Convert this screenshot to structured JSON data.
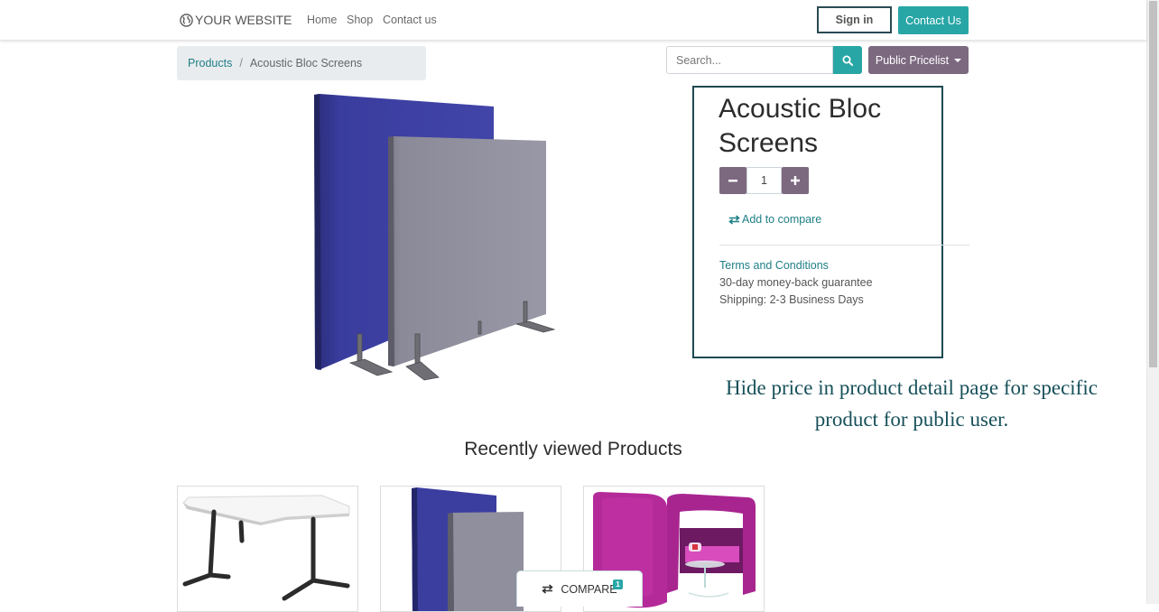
{
  "header": {
    "brand": "YOUR WEBSITE",
    "nav": [
      "Home",
      "Shop",
      "Contact us"
    ],
    "sign_in": "Sign in",
    "contact_us": "Contact Us"
  },
  "breadcrumb": {
    "parent": "Products",
    "separator": "/",
    "current": "Acoustic Bloc Screens"
  },
  "search": {
    "placeholder": "Search...",
    "value": ""
  },
  "pricelist": {
    "label": "Public Pricelist"
  },
  "product": {
    "name_line1": "Acoustic Bloc",
    "name_line2": "Screens",
    "quantity": "1",
    "compare_label": "Add to compare",
    "terms": "Terms and Conditions",
    "guarantee": "30-day money-back guarantee",
    "shipping": "Shipping: 2-3 Business Days"
  },
  "annotation": {
    "line1": "Hide price in product detail page for specific",
    "line2": "product for public user."
  },
  "recently_viewed": {
    "heading": "Recently viewed Products",
    "items": [
      {
        "icon": "corner-desk-image"
      },
      {
        "icon": "acoustic-screens-image"
      },
      {
        "icon": "magenta-booth-image"
      }
    ]
  },
  "compare_bar": {
    "label": "COMPARE",
    "count": "1"
  },
  "colors": {
    "teal": "#28a6a6",
    "link": "#1e7f86",
    "mauve": "#7c6980",
    "annotation": "#17505a",
    "highlight_border": "#1e4a52"
  }
}
